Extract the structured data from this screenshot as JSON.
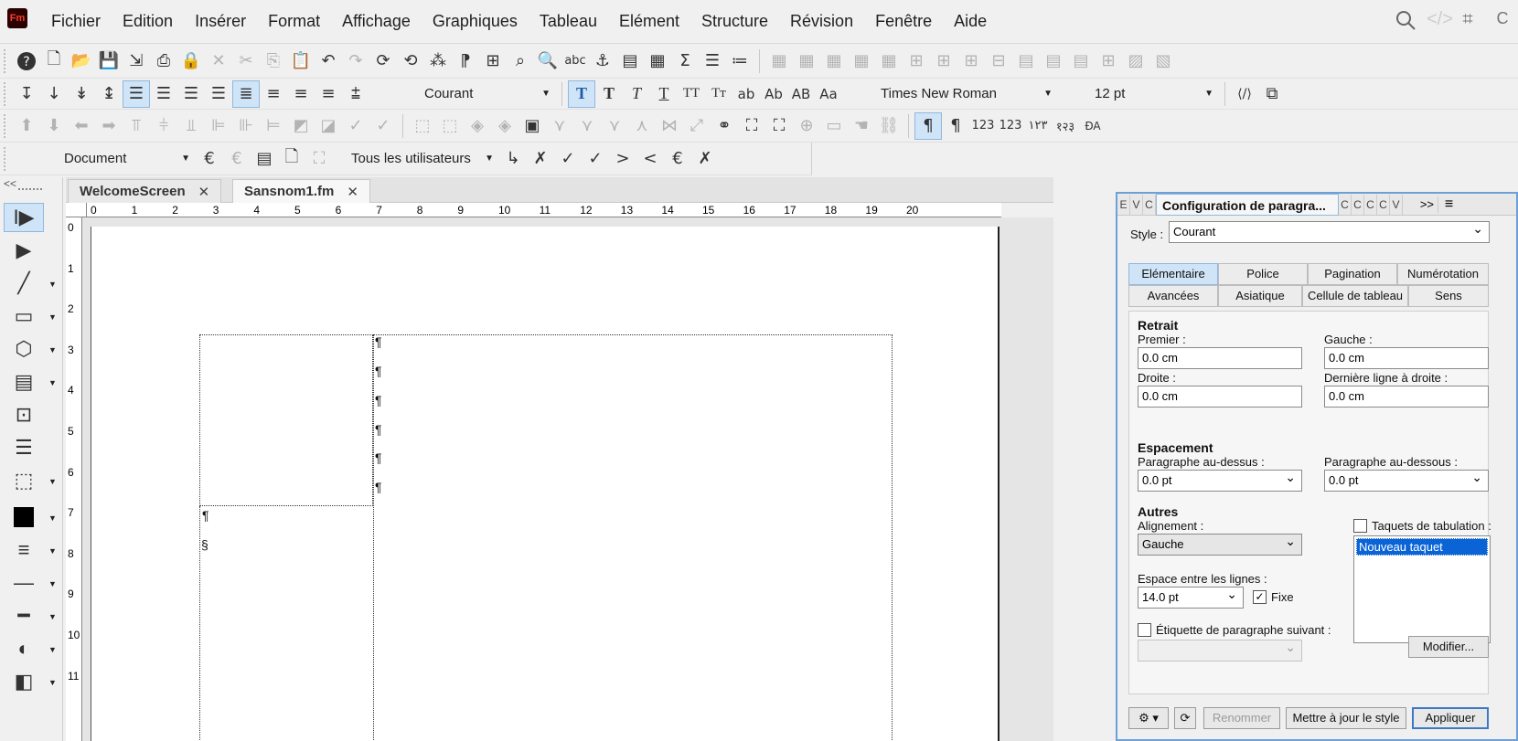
{
  "app": {
    "logo": "Fm"
  },
  "menu": [
    "Fichier",
    "Edition",
    "Insérer",
    "Format",
    "Affichage",
    "Graphiques",
    "Tableau",
    "Elément",
    "Structure",
    "Révision",
    "Fenêtre",
    "Aide"
  ],
  "topright": {
    "search_icon": "search-icon",
    "code_icon": "code-icon",
    "crop_icon": "crop-icon",
    "extra": "C"
  },
  "toolbar1": [
    "?",
    "🗋",
    "📂",
    "💾",
    "⇲",
    "🖶",
    "🔒",
    "✕",
    "✂",
    "⎘",
    "📋",
    "↶",
    "↷",
    "⟳",
    "⟲",
    "⧉",
    "⧉",
    "⧉",
    "🔍",
    "🔎",
    "abc",
    "⚓",
    "▤",
    "▦",
    "Σ",
    "≡",
    "≔"
  ],
  "toolbar2": {
    "alignments": [
      "↧",
      "↓",
      "↡",
      "↨"
    ],
    "para_style": "Courant",
    "char_buttons": [
      "T",
      "T",
      "T",
      "T",
      "TT",
      "Tт",
      "ab",
      "Ab",
      "AB",
      "Aa"
    ],
    "font": "Times New Roman",
    "size": "12 pt"
  },
  "toolbar4": {
    "view": "Document",
    "users": "Tous les utilisateurs"
  },
  "tabs": [
    {
      "label": "WelcomeScreen",
      "close": "✕"
    },
    {
      "label": "Sansnom1.fm",
      "close": "✕"
    }
  ],
  "hruler": [
    "0",
    "1",
    "2",
    "3",
    "4",
    "5",
    "6",
    "7",
    "8",
    "9",
    "10",
    "11",
    "12",
    "13",
    "14",
    "15",
    "16",
    "17",
    "18",
    "19",
    "20"
  ],
  "vruler": [
    "0",
    "1",
    "2",
    "3",
    "4",
    "5",
    "6",
    "7",
    "8",
    "9",
    "10",
    "11"
  ],
  "doc": {
    "pilcrow": "¶",
    "section": "§"
  },
  "panel": {
    "small_tabs_left": [
      "E",
      "V",
      "C"
    ],
    "title": "Configuration de paragra...",
    "small_tabs_right": [
      "C",
      "C",
      "C",
      "C",
      "V"
    ],
    "more": ">>",
    "menu_icon": "≡",
    "style_label": "Style :",
    "style_value": "Courant",
    "tabs_row1": [
      "Elémentaire",
      "Police",
      "Pagination",
      "Numérotation"
    ],
    "tabs_row2": [
      "Avancées",
      "Asiatique",
      "Cellule de tableau",
      "Sens"
    ],
    "retrait": "Retrait",
    "premier_label": "Premier :",
    "premier": "0.0 cm",
    "gauche_label": "Gauche :",
    "gauche": "0.0 cm",
    "droite_label": "Droite :",
    "droite": "0.0 cm",
    "derniere_label": "Dernière ligne à droite :",
    "derniere": "0.0 cm",
    "espacement": "Espacement",
    "dessus_label": "Paragraphe au-dessus :",
    "dessus": "0.0 pt",
    "dessous_label": "Paragraphe au-dessous :",
    "dessous": "0.0 pt",
    "autres": "Autres",
    "alignement_label": "Alignement :",
    "alignement": "Gauche",
    "taquets_label": "Taquets de tabulation :",
    "taquet_item": "Nouveau taquet",
    "espace_label": "Espace entre les lignes :",
    "espace": "14.0 pt",
    "fixe_label": "Fixe",
    "fixe_check": "✓",
    "etiquette_label": "Étiquette de paragraphe suivant :",
    "modifier": "Modifier...",
    "renommer": "Renommer",
    "mettre_a_jour": "Mettre à jour le style",
    "appliquer": "Appliquer"
  },
  "colors": {
    "accent": "#3b79c6",
    "selection": "#0a64d6",
    "logo_bg": "#2b0000",
    "logo_fg": "#ff3c2a"
  }
}
